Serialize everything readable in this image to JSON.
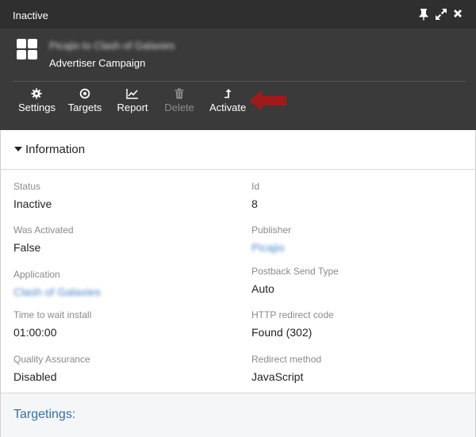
{
  "window": {
    "title": "Inactive"
  },
  "header": {
    "entity_name": "Picajio to Clash of Galaxies",
    "entity_type": "Advertiser Campaign"
  },
  "toolbar": {
    "settings_label": "Settings",
    "targets_label": "Targets",
    "report_label": "Report",
    "delete_label": "Delete",
    "activate_label": "Activate"
  },
  "information": {
    "title": "Information",
    "fields": {
      "status": {
        "label": "Status",
        "value": "Inactive"
      },
      "id": {
        "label": "Id",
        "value": "8"
      },
      "was_activated": {
        "label": "Was Activated",
        "value": "False"
      },
      "publisher": {
        "label": "Publisher",
        "value": "Picajio"
      },
      "application": {
        "label": "Application",
        "value": "Clash of Galaxies"
      },
      "postback_send_type": {
        "label": "Postback Send Type",
        "value": "Auto"
      },
      "time_to_wait_install": {
        "label": "Time to wait install",
        "value": "01:00:00"
      },
      "http_redirect_code": {
        "label": "HTTP redirect code",
        "value": "Found (302)"
      },
      "quality_assurance": {
        "label": "Quality Assurance",
        "value": "Disabled"
      },
      "redirect_method": {
        "label": "Redirect method",
        "value": "JavaScript"
      }
    }
  },
  "targetings": {
    "title": "Targetings:"
  },
  "colors": {
    "titlebar_bg": "#2f2f2f",
    "header_bg": "#3a3a3a",
    "link": "#4a86c8",
    "annotation_arrow": "#a11a1a",
    "section_title": "#3a6f9e"
  }
}
